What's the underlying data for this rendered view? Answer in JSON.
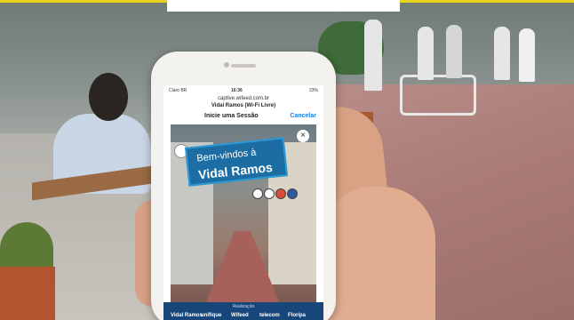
{
  "phone": {
    "status": {
      "carrier": "Claro BR",
      "time": "16:36",
      "battery": "23%"
    },
    "url": "captive.wifeed.com.br",
    "ssid": "Vidal Ramos (Wi-Fi Livre)",
    "nav": {
      "title": "Inicie uma Sessão",
      "cancel": "Cancelar"
    },
    "portal": {
      "welcome_line1": "Bem-vindos à",
      "welcome_line2": "Vidal Ramos"
    },
    "footer": {
      "label": "Realização",
      "logos": [
        "Vidal Ramos",
        "unifique",
        "Wifeed",
        "telecom",
        "Floripa"
      ]
    }
  }
}
